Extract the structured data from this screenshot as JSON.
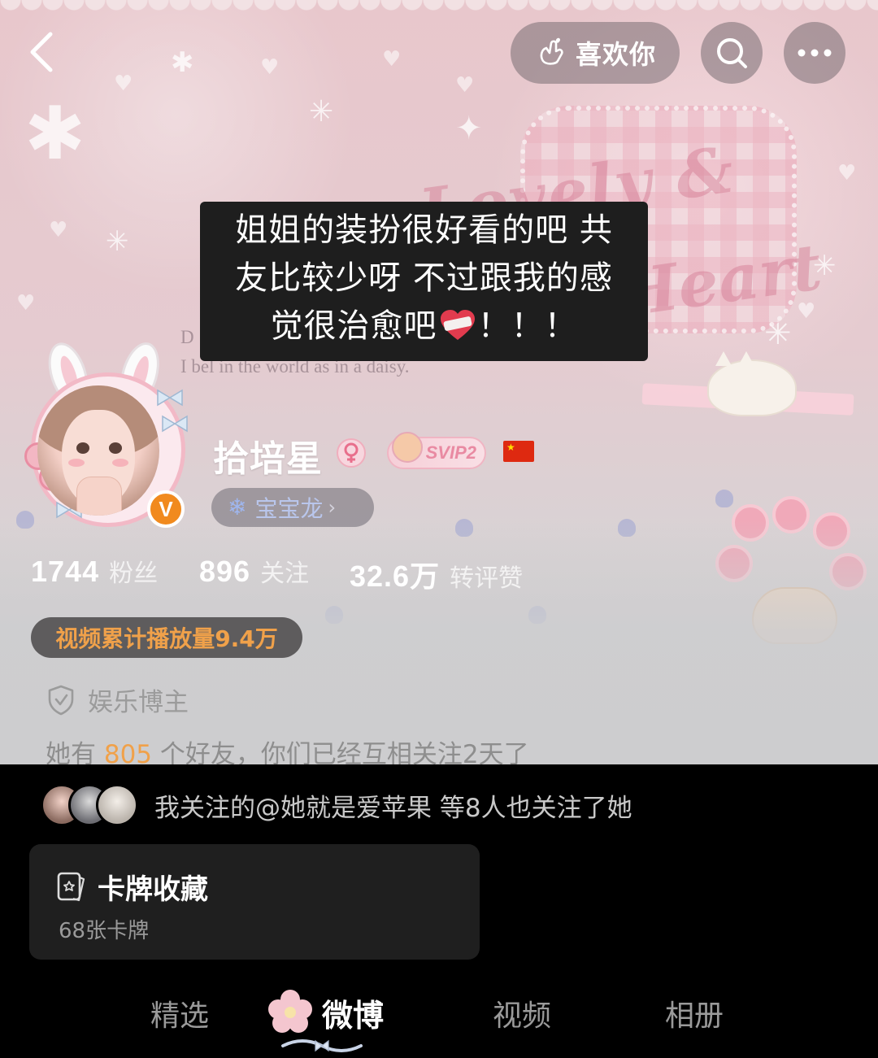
{
  "topbar": {
    "like_label": "喜欢你"
  },
  "caption": {
    "line1": "姐姐的装扮很好看的吧 共",
    "line2": "友比较少呀 不过跟我的感",
    "line3_before": "觉很治愈吧",
    "line3_after": "！！！"
  },
  "banner": {
    "text_lovely": "Lovely &",
    "text_heart": "Heart",
    "daisy_d": "D",
    "daisy_line": "I bel    in the world as in a daisy."
  },
  "profile": {
    "name": "拾培星",
    "svip_label": "SVIP2",
    "dragon_label": "宝宝龙",
    "verified_mark": "V",
    "stats": [
      {
        "num": "1744",
        "label": "粉丝"
      },
      {
        "num": "896",
        "label": "关注"
      },
      {
        "num": "32.6万",
        "label": "转评赞"
      }
    ],
    "play_count": "视频累计播放量9.4万",
    "role": "娱乐博主",
    "friends_prefix": "她有 ",
    "friends_count": "805",
    "friends_suffix": " 个好友，你们已经互相关注2天了"
  },
  "mutual": {
    "text": "我关注的@她就是爱苹果 等8人也关注了她"
  },
  "card_collection": {
    "title": "卡牌收藏",
    "subtitle": "68张卡牌"
  },
  "tabs": [
    {
      "label": "精选"
    },
    {
      "label": "微博",
      "active": true
    },
    {
      "label": "视频"
    },
    {
      "label": "相册"
    }
  ],
  "colors": {
    "accent_orange": "#f0a14a",
    "verified_orange": "#f18a1e",
    "caption_bg": "#1e1e1e",
    "dark_bg": "#000000",
    "card_bg": "#1f1f1f"
  }
}
